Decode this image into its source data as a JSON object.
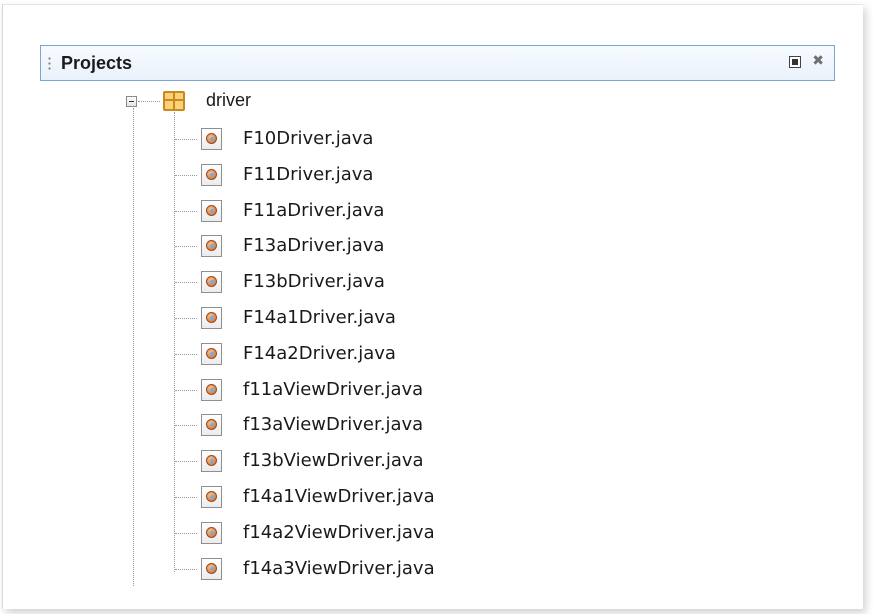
{
  "panel": {
    "title": "Projects",
    "maximize_icon": "maximize-window-icon",
    "close_icon": "close-icon"
  },
  "tree": {
    "package": {
      "label": "driver",
      "expanded": true,
      "icon": "package-icon"
    },
    "files": [
      {
        "label": "F10Driver.java",
        "icon": "java-file-icon"
      },
      {
        "label": "F11Driver.java",
        "icon": "java-file-icon"
      },
      {
        "label": "F11aDriver.java",
        "icon": "java-file-icon"
      },
      {
        "label": "F13aDriver.java",
        "icon": "java-file-icon"
      },
      {
        "label": "F13bDriver.java",
        "icon": "java-file-icon"
      },
      {
        "label": "F14a1Driver.java",
        "icon": "java-file-icon"
      },
      {
        "label": "F14a2Driver.java",
        "icon": "java-file-icon"
      },
      {
        "label": "f11aViewDriver.java",
        "icon": "java-file-icon"
      },
      {
        "label": "f13aViewDriver.java",
        "icon": "java-file-icon"
      },
      {
        "label": "f13bViewDriver.java",
        "icon": "java-file-icon"
      },
      {
        "label": "f14a1ViewDriver.java",
        "icon": "java-file-icon"
      },
      {
        "label": "f14a2ViewDriver.java",
        "icon": "java-file-icon"
      },
      {
        "label": "f14a3ViewDriver.java",
        "icon": "java-file-icon"
      }
    ]
  },
  "colors": {
    "header_border": "#7aa6d4",
    "header_background": "#eef4fc",
    "package_icon": "#fbd27a"
  }
}
